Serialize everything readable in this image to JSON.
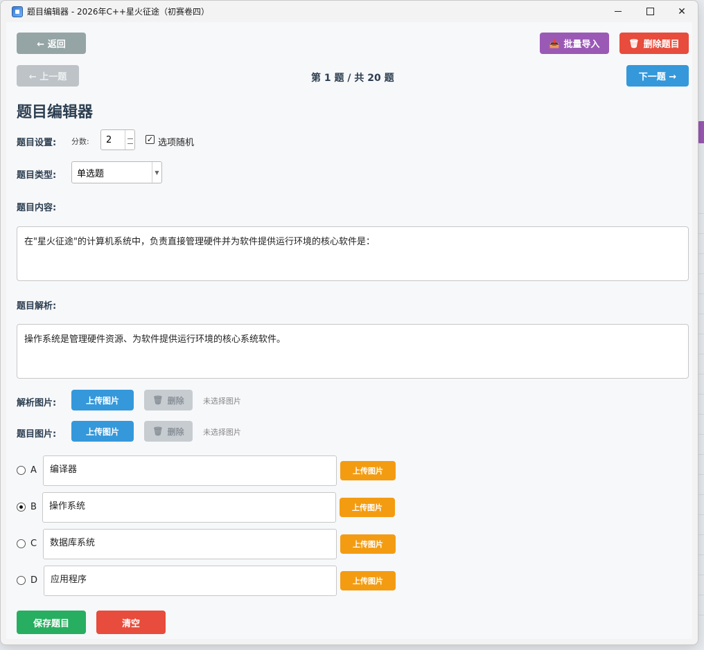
{
  "window": {
    "title": "题目编辑器 - 2026年C++星火征途（初赛卷四）"
  },
  "toolbar": {
    "back_label": "← 返回",
    "import_label": "批量导入",
    "delete_question_label": "删除题目"
  },
  "nav": {
    "prev_label": "← 上一题",
    "counter": "第 1 题 / 共 20 题",
    "next_label": "下一题 →"
  },
  "heading": "题目编辑器",
  "settings": {
    "label": "题目设置:",
    "score_label": "分数:",
    "score_value": "2",
    "shuffle_label": "选项随机",
    "shuffle_checked": true
  },
  "type": {
    "label": "题目类型:",
    "value": "单选题"
  },
  "content": {
    "label": "题目内容:",
    "text": "在\"星火征途\"的计算机系统中，负责直接管理硬件并为软件提供运行环境的核心软件是："
  },
  "analysis": {
    "label": "题目解析:",
    "text": "操作系统是管理硬件资源、为软件提供运行环境的核心系统软件。"
  },
  "analysis_image": {
    "label": "解析图片:",
    "upload_label": "上传图片",
    "delete_label": "删除",
    "status": "未选择图片"
  },
  "question_image": {
    "label": "题目图片:",
    "upload_label": "上传图片",
    "delete_label": "删除",
    "status": "未选择图片"
  },
  "options": [
    {
      "letter": "A",
      "text": "编译器",
      "upload_label": "上传图片",
      "selected": false
    },
    {
      "letter": "B",
      "text": "操作系统",
      "upload_label": "上传图片",
      "selected": true
    },
    {
      "letter": "C",
      "text": "数据库系统",
      "upload_label": "上传图片",
      "selected": false
    },
    {
      "letter": "D",
      "text": "应用程序",
      "upload_label": "上传图片",
      "selected": false
    }
  ],
  "footer": {
    "save_label": "保存题目",
    "clear_label": "清空"
  }
}
